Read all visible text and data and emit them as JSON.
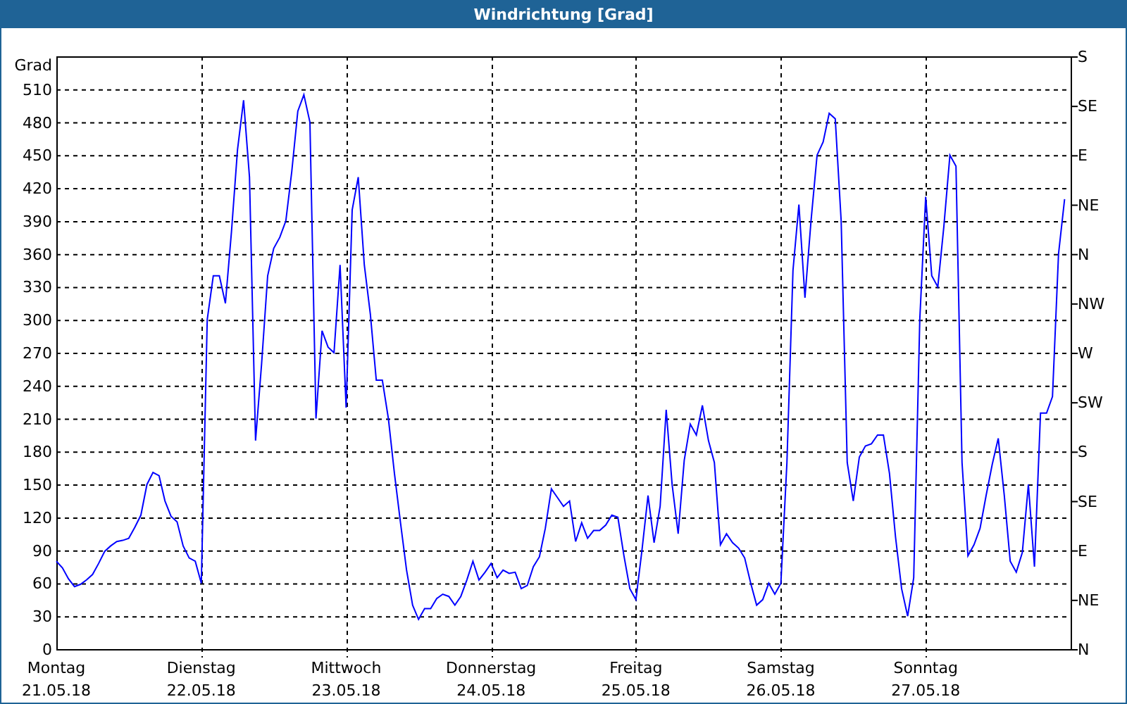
{
  "window": {
    "title": "Windrichtung [Grad]"
  },
  "chart": {
    "right_axis_labels": [
      "S",
      "SE",
      "E",
      "NE",
      "N",
      "NW",
      "W",
      "SW",
      "S",
      "SE",
      "E",
      "NE",
      "N"
    ],
    "chart_data": {
      "type": "line",
      "ylabel": "Grad",
      "ylim": [
        0,
        540
      ],
      "grid": true,
      "yticks": [
        0,
        30,
        60,
        90,
        120,
        150,
        180,
        210,
        240,
        270,
        300,
        330,
        360,
        390,
        420,
        450,
        480,
        510
      ],
      "categories": [
        "Montag\n21.05.18",
        null,
        null,
        null,
        null,
        null,
        null,
        null,
        null,
        null,
        null,
        null,
        null,
        null,
        null,
        null,
        null,
        null,
        null,
        null,
        null,
        null,
        null,
        null,
        "Dienstag\n22.05.18",
        null,
        null,
        null,
        null,
        null,
        null,
        null,
        null,
        null,
        null,
        null,
        null,
        null,
        null,
        null,
        null,
        null,
        null,
        null,
        null,
        null,
        null,
        null,
        "Mittwoch\n23.05.18",
        null,
        null,
        null,
        null,
        null,
        null,
        null,
        null,
        null,
        null,
        null,
        null,
        null,
        null,
        null,
        null,
        null,
        null,
        null,
        null,
        null,
        null,
        null,
        "Donnerstag\n24.05.18",
        null,
        null,
        null,
        null,
        null,
        null,
        null,
        null,
        null,
        null,
        null,
        null,
        null,
        null,
        null,
        null,
        null,
        null,
        null,
        null,
        null,
        null,
        null,
        "Freitag\n25.05.18",
        null,
        null,
        null,
        null,
        null,
        null,
        null,
        null,
        null,
        null,
        null,
        null,
        null,
        null,
        null,
        null,
        null,
        null,
        null,
        null,
        null,
        null,
        null,
        "Samstag\n26.05.18",
        null,
        null,
        null,
        null,
        null,
        null,
        null,
        null,
        null,
        null,
        null,
        null,
        null,
        null,
        null,
        null,
        null,
        null,
        null,
        null,
        null,
        null,
        null,
        "Sonntag\n27.05.18",
        null,
        null,
        null,
        null,
        null,
        null,
        null,
        null,
        null,
        null,
        null,
        null,
        null,
        null,
        null,
        null,
        null,
        null,
        null,
        null,
        null,
        null,
        null
      ],
      "series": [
        {
          "color": "#0000ff",
          "values": [
            80,
            74,
            64,
            57,
            59,
            63,
            68,
            78,
            89,
            94,
            98,
            99,
            101,
            111,
            122,
            150,
            161,
            158,
            135,
            121,
            116,
            94,
            83,
            80,
            60,
            300,
            340,
            340,
            315,
            380,
            455,
            500,
            430,
            190,
            260,
            340,
            365,
            375,
            390,
            435,
            490,
            505,
            480,
            210,
            290,
            275,
            270,
            350,
            220,
            400,
            430,
            350,
            305,
            245,
            245,
            210,
            160,
            115,
            72,
            40,
            27,
            37,
            37,
            46,
            50,
            48,
            40,
            48,
            63,
            80,
            63,
            70,
            78,
            65,
            72,
            69,
            70,
            55,
            58,
            75,
            84,
            110,
            146,
            138,
            130,
            135,
            98,
            115,
            101,
            108,
            108,
            113,
            122,
            120,
            85,
            55,
            45,
            90,
            140,
            97,
            130,
            218,
            150,
            105,
            172,
            205,
            195,
            222,
            190,
            170,
            95,
            105,
            97,
            92,
            83,
            60,
            40,
            45,
            60,
            50,
            60,
            170,
            345,
            405,
            320,
            390,
            450,
            462,
            488,
            483,
            390,
            170,
            135,
            175,
            185,
            187,
            195,
            195,
            160,
            102,
            55,
            30,
            65,
            300,
            412,
            340,
            330,
            385,
            450,
            440,
            170,
            85,
            95,
            110,
            140,
            168,
            192,
            140,
            80,
            70,
            88,
            150,
            75,
            215,
            215,
            230,
            360,
            410
          ]
        }
      ]
    }
  }
}
